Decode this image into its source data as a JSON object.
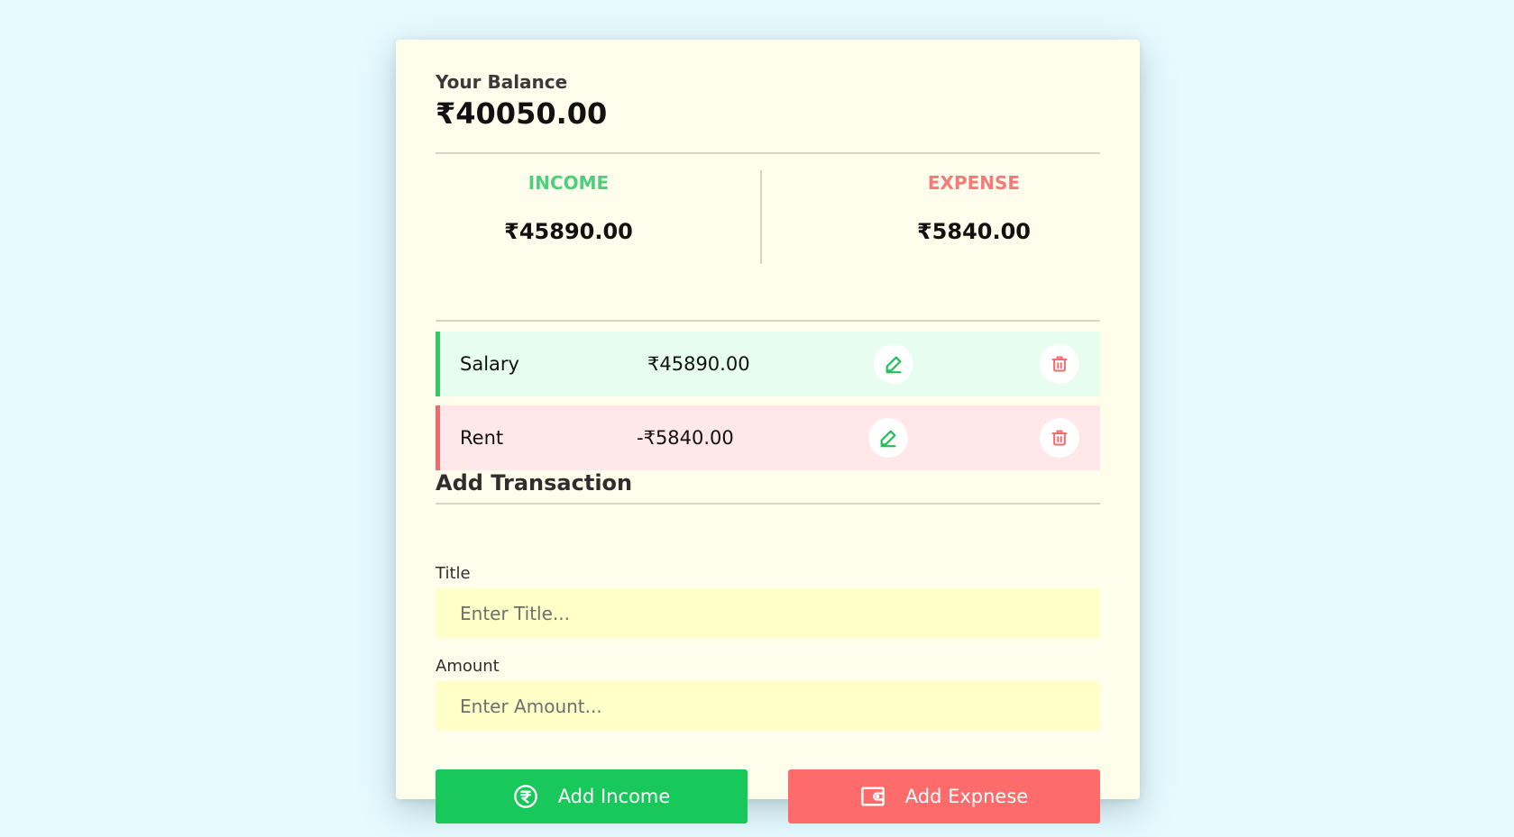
{
  "balance": {
    "label": "Your Balance",
    "value": "₹40050.00"
  },
  "summary": {
    "income": {
      "label": "INCOME",
      "amount": "₹45890.00"
    },
    "expense": {
      "label": "EXPENSE",
      "amount": "₹5840.00"
    }
  },
  "transactions": [
    {
      "title": "Salary",
      "amount": "₹45890.00",
      "type": "income"
    },
    {
      "title": "Rent",
      "amount": "-₹5840.00",
      "type": "expense"
    }
  ],
  "form": {
    "heading": "Add Transaction",
    "title_label": "Title",
    "title_placeholder": "Enter Title...",
    "amount_label": "Amount",
    "amount_placeholder": "Enter Amount..."
  },
  "buttons": {
    "add_income": "Add Income",
    "add_expense": "Add Expnese"
  },
  "colors": {
    "income": "#19c85a",
    "expense": "#fd6b6b",
    "background": "#e7fbff",
    "card": "#fffeec"
  },
  "icons": {
    "edit": "pencil-icon",
    "delete": "trash-icon",
    "income": "rupee-circle-icon",
    "expense": "wallet-icon"
  }
}
